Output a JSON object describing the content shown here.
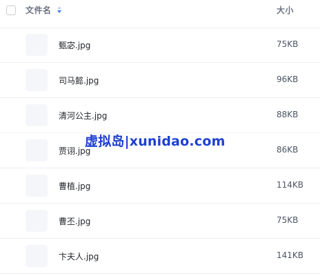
{
  "header": {
    "name_label": "文件名",
    "size_label": "大小",
    "sort_icon": "sort-icon"
  },
  "files": [
    {
      "name": "甄宓.jpg",
      "size": "75KB"
    },
    {
      "name": "司马懿.jpg",
      "size": "96KB"
    },
    {
      "name": "清河公主.jpg",
      "size": "88KB"
    },
    {
      "name": "贾诩.jpg",
      "size": "86KB"
    },
    {
      "name": "曹植.jpg",
      "size": "114KB"
    },
    {
      "name": "曹丕.jpg",
      "size": "75KB"
    },
    {
      "name": "卞夫人.jpg",
      "size": "141KB"
    }
  ],
  "watermark": "虚拟岛|xunidao.com",
  "colors": {
    "watermark": "#1d3fd0",
    "sort_up": "#c6d4f5",
    "sort_down": "#3d7bfa"
  }
}
